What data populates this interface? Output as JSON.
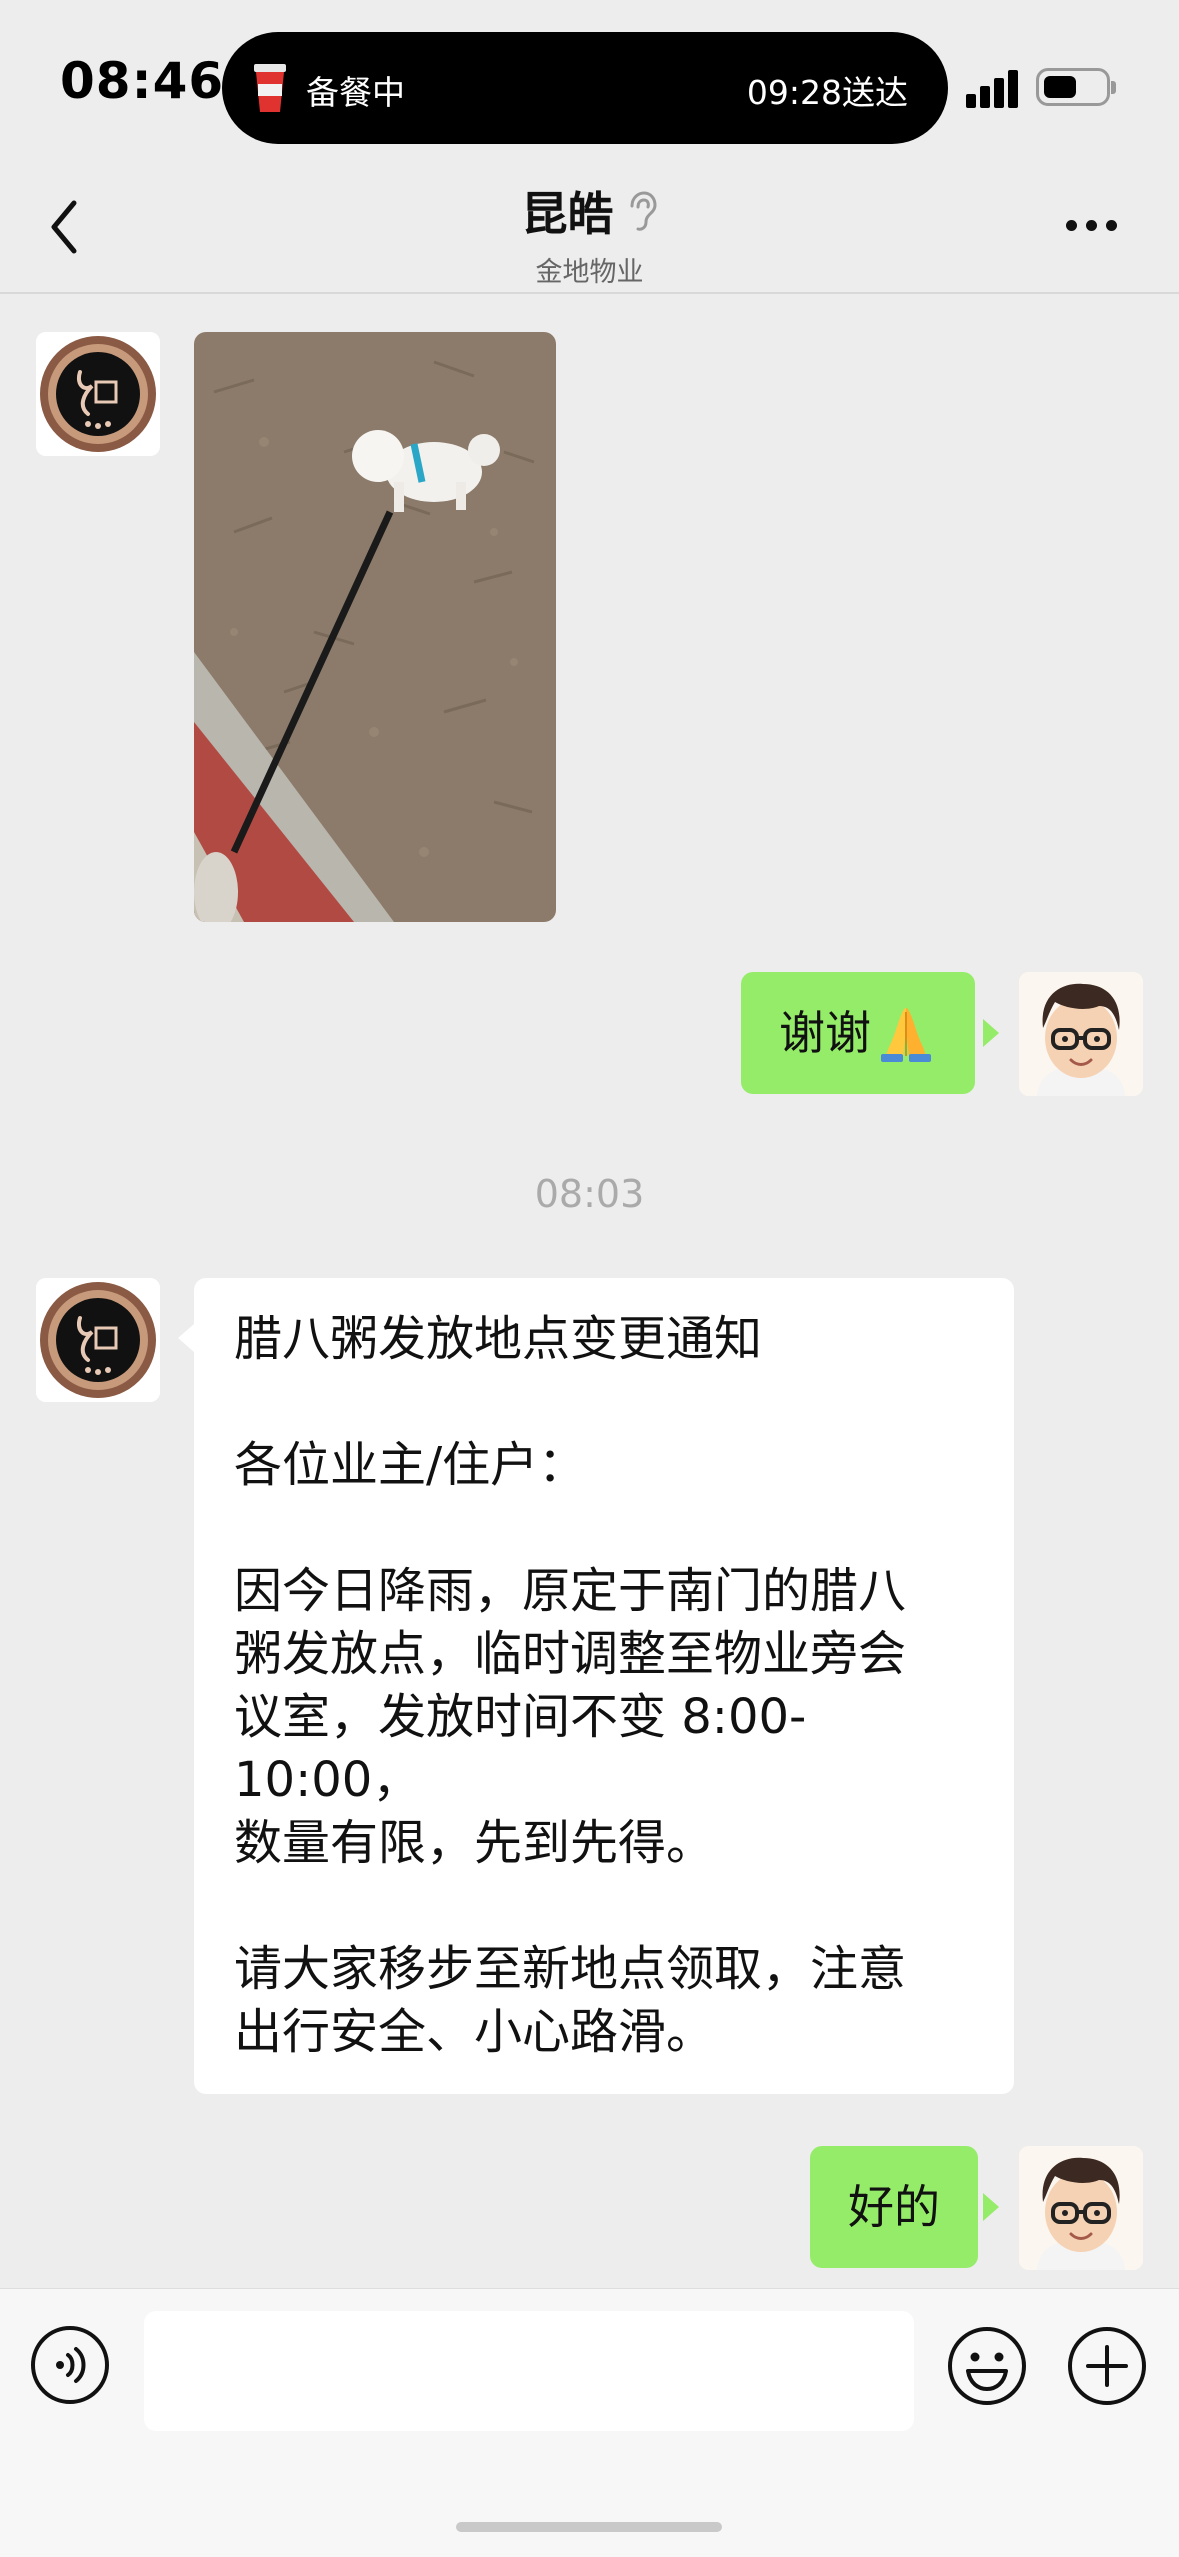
{
  "status_bar": {
    "time": "08:46",
    "live_activity": {
      "status": "备餐中",
      "eta": "09:28送达"
    }
  },
  "nav": {
    "title": "昆皓",
    "subtitle": "金地物业",
    "back_icon": "chevron-left-icon",
    "more_icon": "more-dots-icon",
    "title_icon": "ear-icon"
  },
  "messages": {
    "thanks": "谢谢",
    "thanks_emoji": "folded-hands-emoji",
    "timestamp": "08:03",
    "notice_lines": [
      "腊八粥发放地点变更通知",
      "",
      "各位业主/住户：",
      "",
      "因今日降雨，原定于南门的腊八",
      "粥发放点，临时调整至物业旁会",
      "议室，发放时间不变 8:00-10:00，",
      "数量有限，先到先得。",
      "",
      "请大家移步至新地点领取，注意",
      "出行安全、小心路滑。"
    ],
    "ok": "好的"
  },
  "input_bar": {
    "placeholder": "",
    "voice_icon": "voice-icon",
    "emoji_icon": "emoji-icon",
    "plus_icon": "plus-icon"
  },
  "colors": {
    "background": "#ededed",
    "bubble_self": "#95ec69",
    "bubble_other": "#ffffff",
    "timestamp": "#aaaaaa"
  }
}
